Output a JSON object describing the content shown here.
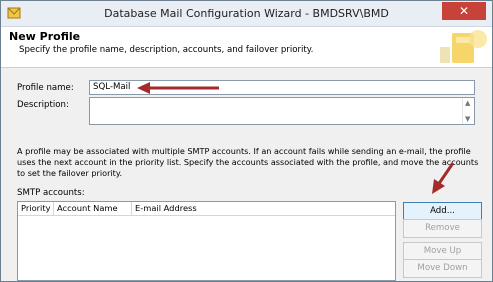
{
  "window": {
    "title": "Database Mail Configuration Wizard - BMDSRV\\BMD",
    "close_glyph": "✕"
  },
  "header": {
    "title": "New Profile",
    "subtitle": "Specify the profile name, description, accounts, and failover priority."
  },
  "form": {
    "profile_name_label": "Profile name:",
    "profile_name_value": "SQL-Mail",
    "description_label": "Description:",
    "description_value": ""
  },
  "info_text": "A profile may be associated with multiple SMTP accounts. If an account fails while sending an e-mail, the profile uses the next account in the priority list. Specify the accounts associated with the profile, and move the accounts to set the failover priority.",
  "smtp": {
    "label": "SMTP accounts:",
    "columns": [
      "Priority",
      "Account Name",
      "E-mail Address"
    ],
    "rows": []
  },
  "buttons": {
    "add": "Add...",
    "remove": "Remove",
    "move_up": "Move Up",
    "move_down": "Move Down"
  },
  "colors": {
    "annotation_arrow": "#a52a2a",
    "button_focus": "#3c7fb1"
  }
}
